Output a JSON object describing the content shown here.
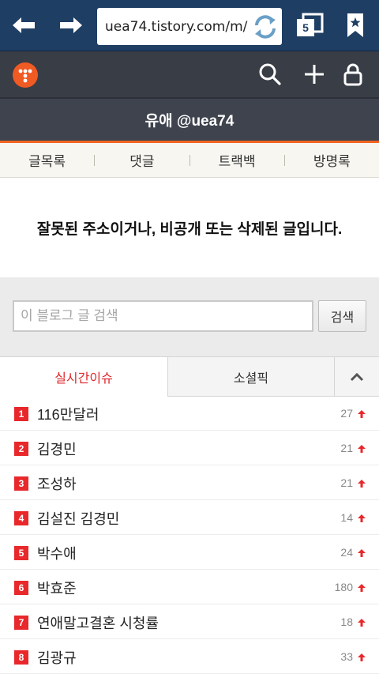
{
  "browser": {
    "url": "uea74.tistory.com/m/",
    "tab_count": "5"
  },
  "blog": {
    "title": "유애 @uea74"
  },
  "nav": {
    "items": [
      "글목록",
      "댓글",
      "트랙백",
      "방명록"
    ]
  },
  "message": "잘못된 주소이거나, 비공개 또는 삭제된 글입니다.",
  "search": {
    "placeholder": "이 블로그 글 검색",
    "button_label": "검색"
  },
  "issues": {
    "tab_live": "실시간이슈",
    "tab_social": "소셜픽",
    "items": [
      {
        "rank": "1",
        "keyword": "116만달러",
        "count": "27"
      },
      {
        "rank": "2",
        "keyword": "김경민",
        "count": "21"
      },
      {
        "rank": "3",
        "keyword": "조성하",
        "count": "21"
      },
      {
        "rank": "4",
        "keyword": "김설진 김경민",
        "count": "14"
      },
      {
        "rank": "5",
        "keyword": "박수애",
        "count": "24"
      },
      {
        "rank": "6",
        "keyword": "박효준",
        "count": "180"
      },
      {
        "rank": "7",
        "keyword": "연애말고결혼 시청률",
        "count": "18"
      },
      {
        "rank": "8",
        "keyword": "김광규",
        "count": "33"
      }
    ]
  },
  "colors": {
    "browser_bar": "#1f3e63",
    "header": "#393d46",
    "accent": "#f26522",
    "rank_badge": "#e8282b",
    "live_tab": "#e0272b"
  },
  "icons": {
    "back": "arrow-left-icon",
    "forward": "arrow-right-icon",
    "reload": "reload-icon",
    "tabs": "tabs-icon",
    "bookmark": "bookmark-star-icon",
    "logo": "tistory-logo-icon",
    "search": "search-icon",
    "plus": "plus-icon",
    "lock": "lock-icon",
    "collapse": "chevron-up-icon",
    "rise": "rise-arrow-icon"
  }
}
